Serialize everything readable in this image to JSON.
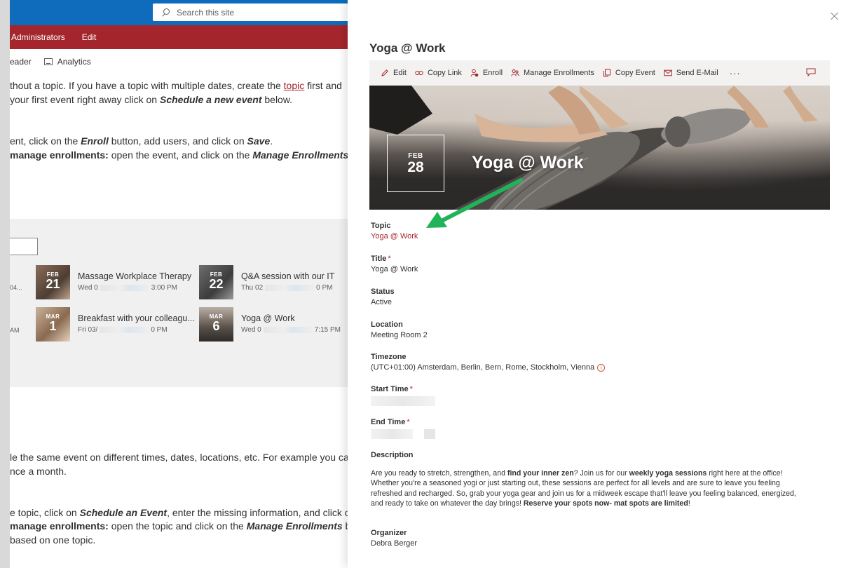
{
  "site": {
    "search_placeholder": "Search this site",
    "nav_items": [
      "Administrators",
      "Edit"
    ],
    "cmd_reader": "eader",
    "cmd_analytics": "Analytics",
    "text_lines": {
      "l1_a": "thout a topic. If you have a topic with multiple dates, create the ",
      "l1_link": "topic",
      "l1_b": " first and",
      "l2_a": "your first event right away click on ",
      "l2_em": "Schedule a new event",
      "l2_b": " below.",
      "l3_a": "ent, click on the ",
      "l3_em": "Enroll",
      "l3_b": " button, add users, and click on ",
      "l3_em2": "Save",
      "l3_c": ".",
      "l4_bold": "manage enrollments:",
      "l4_a": " open the event, and click on the ",
      "l4_em": "Manage Enrollments",
      "l5_a": "le the same event on different times, dates, locations, etc. For example you can",
      "l6_a": "nce a month.",
      "l7_a": "e topic, click on ",
      "l7_em": "Schedule an Event",
      "l7_b": ", enter the missing information, and click o",
      "l8_bold": "manage enrollments:",
      "l8_a": " open the topic and click on the ",
      "l8_em": "Manage Enrollments",
      "l8_b": " b",
      "l9_a": "based on one topic."
    },
    "events": [
      {
        "month": "FEB",
        "day": "21",
        "title": "Massage Workplace Therapy",
        "date_prefix": "Wed 0",
        "time": "3:00 PM"
      },
      {
        "month": "FEB",
        "day": "22",
        "title": "Q&A session with our IT",
        "date_prefix": "Thu 02",
        "time": "0 PM"
      },
      {
        "month": "MAR",
        "day": "1",
        "title": "Breakfast with your colleagu...",
        "date_prefix": "Fri 03/",
        "time": "0 PM"
      },
      {
        "month": "MAR",
        "day": "6",
        "title": "Yoga @ Work",
        "date_prefix": "Wed 0",
        "time": "7:15 PM"
      }
    ],
    "partial_left": [
      "04...",
      "AM"
    ]
  },
  "panel": {
    "title": "Yoga @ Work",
    "toolbar": {
      "edit": "Edit",
      "copy_link": "Copy Link",
      "enroll": "Enroll",
      "manage_enrollments": "Manage Enrollments",
      "copy_event": "Copy Event",
      "send_email": "Send E-Mail",
      "more": "···"
    },
    "hero": {
      "month": "FEB",
      "day": "28",
      "title": "Yoga @ Work"
    },
    "fields": {
      "topic_label": "Topic",
      "topic_value": "Yoga @ Work",
      "title_label": "Title",
      "title_value": "Yoga @ Work",
      "status_label": "Status",
      "status_value": "Active",
      "location_label": "Location",
      "location_value": "Meeting Room 2",
      "timezone_label": "Timezone",
      "timezone_value": "(UTC+01:00) Amsterdam, Berlin, Bern, Rome, Stockholm, Vienna",
      "start_label": "Start Time",
      "end_label": "End Time",
      "description_label": "Description",
      "organizer_label": "Organizer",
      "organizer_value": "Debra Berger",
      "required_mark": "*"
    },
    "description": {
      "p1": "Are you ready to stretch, strengthen, and ",
      "b1": "find your inner zen",
      "p2": "? Join us for our ",
      "b2": "weekly yoga sessions",
      "p3": " right here at the office! Whether you're a seasoned yogi or just starting out, these sessions are perfect for all levels and are sure to leave you feeling refreshed and recharged. So, grab your yoga gear and join us for a midweek escape that'll leave you feeling balanced, energized, and ready to take on whatever the day brings! ",
      "b3": "Reserve your spots now- mat spots are limited",
      "p4": "!"
    }
  },
  "colors": {
    "accent_red": "#a4262c",
    "suite_blue": "#0f6cbd",
    "arrow_green": "#21b35a"
  }
}
